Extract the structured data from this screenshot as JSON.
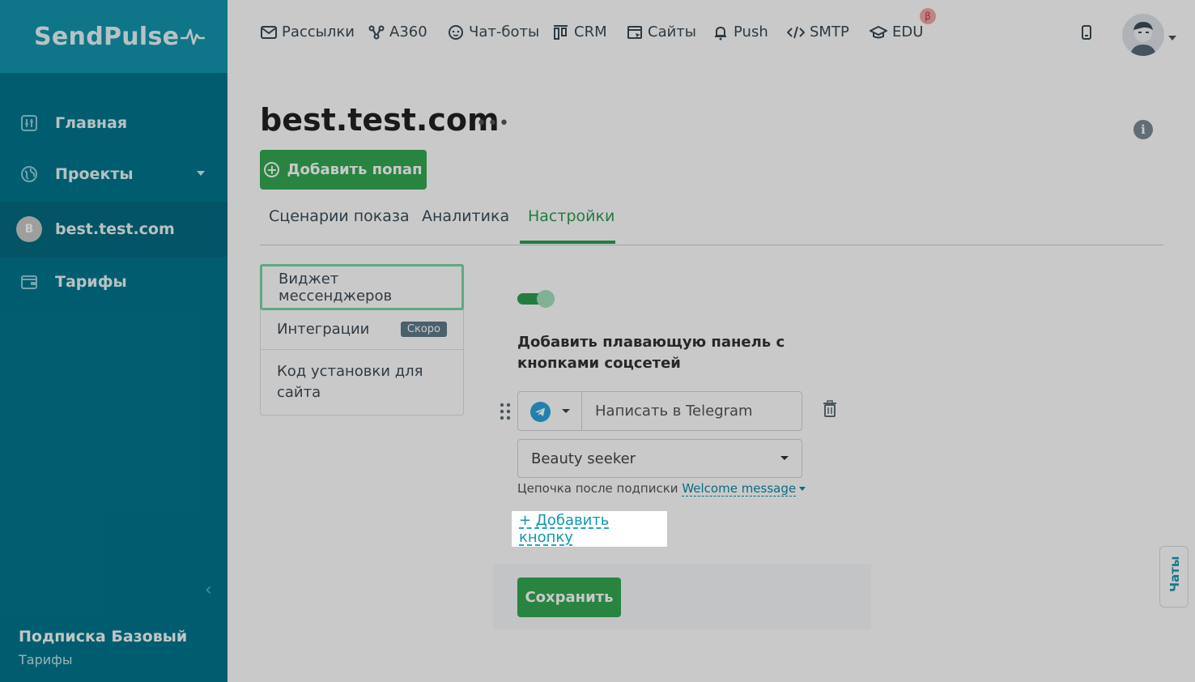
{
  "brand": {
    "name": "SendPulse"
  },
  "sidebar": {
    "items": [
      {
        "label": "Главная",
        "icon": "dashboard-icon"
      },
      {
        "label": "Проекты",
        "icon": "globe-icon"
      },
      {
        "label": "best.test.com",
        "avatar_letter": "B"
      },
      {
        "label": "Тарифы",
        "icon": "wallet-icon"
      }
    ],
    "subscription_title": "Подписка Базовый",
    "subscription_link": "Тарифы",
    "collapse_glyph": "‹"
  },
  "topnav": {
    "items": [
      {
        "label": "Рассылки",
        "icon": "mail-icon"
      },
      {
        "label": "A360",
        "icon": "automation-icon"
      },
      {
        "label": "Чат-боты",
        "icon": "chatbot-icon"
      },
      {
        "label": "CRM",
        "icon": "crm-icon"
      },
      {
        "label": "Сайты",
        "icon": "sites-icon"
      },
      {
        "label": "Push",
        "icon": "bell-icon"
      },
      {
        "label": "SMTP",
        "icon": "code-icon"
      },
      {
        "label": "EDU",
        "icon": "graduation-cap-icon"
      }
    ],
    "beta_badge": "β"
  },
  "page": {
    "title": "best.test.com",
    "more": "•••",
    "info": "i",
    "add_popup_label": "Добавить попап",
    "tabs": [
      {
        "label": "Сценарии показа",
        "active": false
      },
      {
        "label": "Аналитика",
        "active": false
      },
      {
        "label": "Настройки",
        "active": true
      }
    ]
  },
  "settings_menu": {
    "items": [
      {
        "label": "Виджет мессенджеров",
        "selected": true
      },
      {
        "label": "Интеграции",
        "badge": "Скоро"
      },
      {
        "label": "Код установки для сайта"
      }
    ]
  },
  "widget": {
    "enabled": true,
    "heading": "Добавить плавающую панель с кнопками соцсетей",
    "messenger_icon": "telegram-icon",
    "button_text": "Написать в Telegram",
    "bot_select": "Beauty seeker",
    "chain_label": "Цепочка после подписки",
    "chain_value": "Welcome message",
    "add_button_label": "+ Добавить кнопку",
    "save_label": "Сохранить"
  },
  "chats_tab": {
    "label": "Чаты"
  },
  "colors": {
    "sidebar": "#00778f",
    "logo_bar": "#1296ad",
    "accent_green": "#34a853",
    "link_teal": "#0e98b0"
  }
}
